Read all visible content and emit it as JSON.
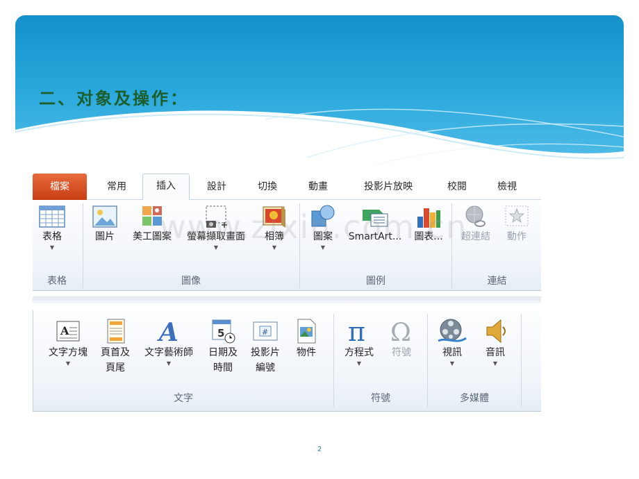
{
  "slide": {
    "title": "二、对象及操作：",
    "page_number": "2",
    "watermark": "www.zixin.com.cn"
  },
  "ribbon_tabs": [
    "檔案",
    "常用",
    "插入",
    "設計",
    "切換",
    "動畫",
    "投影片放映",
    "校閱",
    "檢視"
  ],
  "active_tab": "插入",
  "groups_row1": {
    "table": {
      "label": "表格",
      "buttons": {
        "table": "表格"
      }
    },
    "image": {
      "label": "圖像",
      "buttons": {
        "picture": "圖片",
        "clipart": "美工圖案",
        "screenshot": "螢幕擷取畫面",
        "album": "相簿"
      }
    },
    "illustrations": {
      "label": "圖例",
      "buttons": {
        "shapes": "圖案",
        "smartart": "SmartArt...",
        "chart": "圖表..."
      }
    },
    "links": {
      "label": "連結",
      "buttons": {
        "hyperlink": "超連結",
        "action": "動作"
      }
    }
  },
  "groups_row2": {
    "text": {
      "label": "文字",
      "buttons": {
        "textbox": "文字方塊",
        "header_line1": "頁首及",
        "header_line2": "頁尾",
        "wordart": "文字藝術師",
        "datetime_line1": "日期及",
        "datetime_line2": "時間",
        "slidenum_line1": "投影片",
        "slidenum_line2": "編號",
        "object": "物件"
      }
    },
    "symbols": {
      "label": "符號",
      "buttons": {
        "equation": "方程式",
        "symbol": "符號"
      }
    },
    "media": {
      "label": "多媒體",
      "buttons": {
        "video": "視訊",
        "audio": "音訊"
      }
    }
  },
  "colors": {
    "banner": "#1590c9",
    "title_text": "#1c5e2c",
    "file_tab": "#d24f22",
    "page_number": "#2e7fbf"
  }
}
